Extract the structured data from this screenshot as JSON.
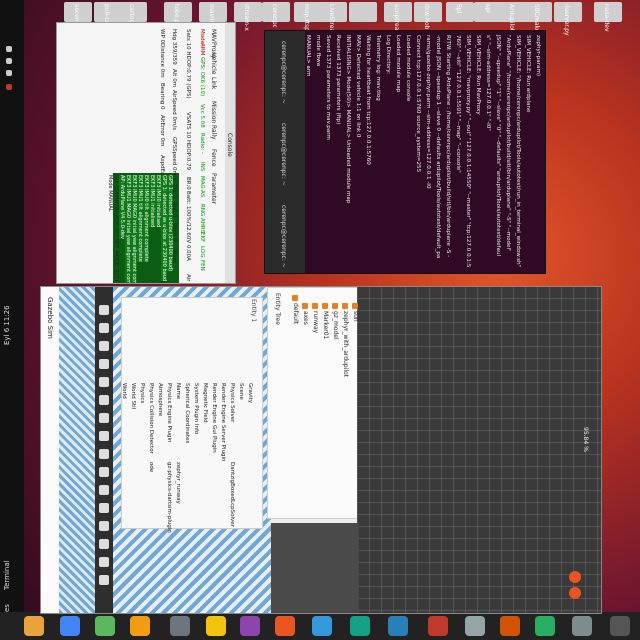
{
  "panel": {
    "activities": "Activities",
    "terminal_app": "Terminal",
    "clock": "Eyl 6 11:26",
    "battery": "%"
  },
  "desktop_icons": [
    "ascent-ardupilot",
    "pull-cam",
    "cartographer",
    "tobe.py",
    "mavlink",
    "stream-x",
    "cerenpc",
    "map.rtsp",
    "LiveStream-C23-main",
    "",
    "scriptreader",
    "dcw-hob",
    "Spl",
    "MP",
    "ArdupilotCs",
    "SBCmake",
    "dserver.py",
    "nasa-dev"
  ],
  "mavproxy": {
    "title": "Console",
    "status_row1": [
      "Mode",
      "ARM",
      "GPS: OK6 (10)",
      "Vcc 5.08",
      "Radio: -",
      "INS",
      "MAG",
      "AS",
      "RNG",
      "AHRS",
      "EKF",
      "LOG",
      "FEN"
    ],
    "status_row2": [
      "Sats 10 HDOP:0.79 (GPS)",
      "VSATS 10 HDOP:0.79",
      "BR:0",
      "Batt: 100%/12.60V 0.00A",
      "Air 0.00 m/s",
      "Alt 0.00 m"
    ],
    "status_row3": [
      "Hdg 359/359",
      "Alt 0m",
      "AirSpeed 0m/s",
      "GPSSpeed 0m/s",
      "Thr 0",
      "Roll 0",
      "Pitch 0",
      "Wind"
    ],
    "status_row4": [
      "WP 0",
      "Distance 0m",
      "Bearing 0",
      "AltError 0m",
      "AspdError 0m/s",
      "FlightTime 0:00",
      "ETR 0:00",
      "Param 0/1373"
    ],
    "menu": [
      "MAVProxy",
      "Vehicle",
      "Link",
      "Mission",
      "Rally",
      "Fence",
      "Parameter"
    ],
    "log_lines": [
      "GPS 1: detected u-blox (230400 baud)",
      "GPS 1: detected as u-blox at 230400 baud",
      "EKF3 IMU0 initialised",
      "EKF3 IMU1 initialised",
      "EKF3 IMU0 tilt alignment complete",
      "EKF3 IMU1 tilt alignment complete",
      "EKF3 IMU0 MAG0 initial yaw alignment complete",
      "EKF3 IMU1 MAG0 initial yaw alignment complete",
      "AP: ArduPlane V4.5.0-dev",
      "Got COMMAND_ACK: DO_SET_MODE: ACCEPTED",
      "Mode MANUAL"
    ]
  },
  "gazebo": {
    "title": "Gazebo Sim",
    "entity_tab": "Entity 1",
    "tree_title": "Entity Tree",
    "tree_items": [
      "default",
      "axes",
      "runway",
      "Marker01",
      "gz_model",
      "zephyr_with_ardupilot",
      "sun"
    ],
    "props": [
      [
        "World",
        ""
      ],
      [
        "World Stil",
        ""
      ],
      [
        "Physics",
        ""
      ],
      [
        "Physics Collision Detector",
        "ode"
      ],
      [
        "Atmosphere",
        ""
      ],
      [
        "Physics Engine Plugin",
        "gz-physics-dartsim-plugin"
      ],
      [
        "Name",
        "zephyr_runway"
      ],
      [
        "Spherical Coordinates",
        ""
      ],
      [
        "System Plugin Info",
        ""
      ],
      [
        "Magnetic Field",
        ""
      ],
      [
        "Render Engine Gui Plugin",
        ""
      ],
      [
        "Render Engine Server Plugin",
        ""
      ],
      [
        "Physics Solver",
        "DantzigBoxedLcpSolver"
      ],
      [
        "Scene",
        ""
      ],
      [
        "Gravity",
        ""
      ]
    ],
    "scene_rtf": "95.84 %",
    "tool_icons": [
      "select-icon",
      "translate-icon",
      "rotate-icon",
      "box-icon",
      "sphere-icon",
      "cylinder-icon",
      "capsule-icon",
      "ellipsoid-icon",
      "light-icon",
      "spotlight-icon",
      "dirlight-icon",
      "grid-icon",
      "copy-icon",
      "paste-icon",
      "snap-icon",
      "undo-icon"
    ]
  },
  "terminal": {
    "tabs": [
      "cerenpc@cerenpc: ~",
      "cerenpc@cerenpc: ~",
      "cerenpc@cerenpc: ~"
    ],
    "lines": [
      "zephyr-param)",
      "SIM_VEHICLE: Run ardplane",
      "SIM_VEHICLE: \"/home/cerenpc/ardupilot/Tools/autotest/run_in_terminal_window.sh\"",
      "\"ArduPlane\" \"/home/cerenpc/ardupilot/build/sitl/bin/arduplane\" \"-S\" \"--model\"",
      "JSON\" \"--speedup\" \"1\" \"--slave\" \"0\" \"--defaults\" \"ardupilot/Tools/autotest/defaul",
      "s\" \"--sim-address=127.0.0.1\" \"-I0\"",
      "SIM_VEHICLE: Run MavProxy",
      "SIM_VEHICLE: \"mavproxy.py\" \"--out\" \"127.0.0.1:14550\" \"--master\" \"tcp:127.0.0.1:5",
      "760\" \"--sitl\" \"127.0.0.1:5501\" \"--map\" \"--console\"",
      "RiTW: Starting ArduPlane : /home/cerenpc/ardupilot/build/sitl/bin/arduplane -S -",
      "-model JSON --speedup 1 --slave 0 --defaults ardupilot/Tools/autotest/default_pa",
      "rams/gazebo-zephyr.parm --sim-address=127.0.0.1 -I0",
      "Connect tcp:127.0.0.1:5760 source_system=255",
      "Loaded module console",
      "Loaded module map",
      "Log Directory:",
      "Telemetry log: mav.tlog",
      "Waiting for heartbeat from tcp:127.0.0.1:5760",
      "MAV> Detected vehicle 1:1 on link 0",
      "INITIALISING> Mode(50)> MANUAL> Unloaded module map",
      "Received 1373 parameters (ftp)",
      "Saved 1373 parameters to mav.parm",
      "mode fbwa",
      "MANUAL> arm"
    ]
  },
  "colors": {
    "terminal_bg": "#300a24",
    "accent": "#e95420",
    "gazebo_scene": "#3a3a3a"
  }
}
